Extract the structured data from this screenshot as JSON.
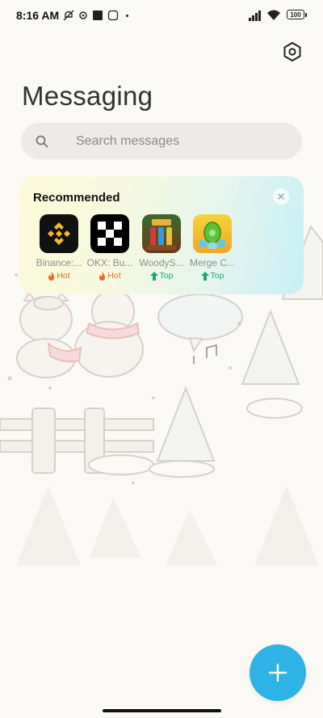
{
  "status_bar": {
    "time": "8:16 AM",
    "battery": "100"
  },
  "page": {
    "title": "Messaging"
  },
  "search": {
    "placeholder": "Search messages"
  },
  "recommended": {
    "title": "Recommended",
    "apps": [
      {
        "name": "Binance:...",
        "tag": "Hot",
        "tag_type": "hot"
      },
      {
        "name": "OKX: Bu...",
        "tag": "Hot",
        "tag_type": "hot"
      },
      {
        "name": "WoodyS...",
        "tag": "Top",
        "tag_type": "top"
      },
      {
        "name": "Merge C...",
        "tag": "Top",
        "tag_type": "top"
      }
    ]
  },
  "colors": {
    "accent": "#2db3e6",
    "hot": "#f06a1a",
    "top": "#1ca779"
  },
  "icons": {
    "settings": "settings-hexagon-icon",
    "search": "search-icon",
    "compose": "plus-icon",
    "close": "close-icon"
  }
}
